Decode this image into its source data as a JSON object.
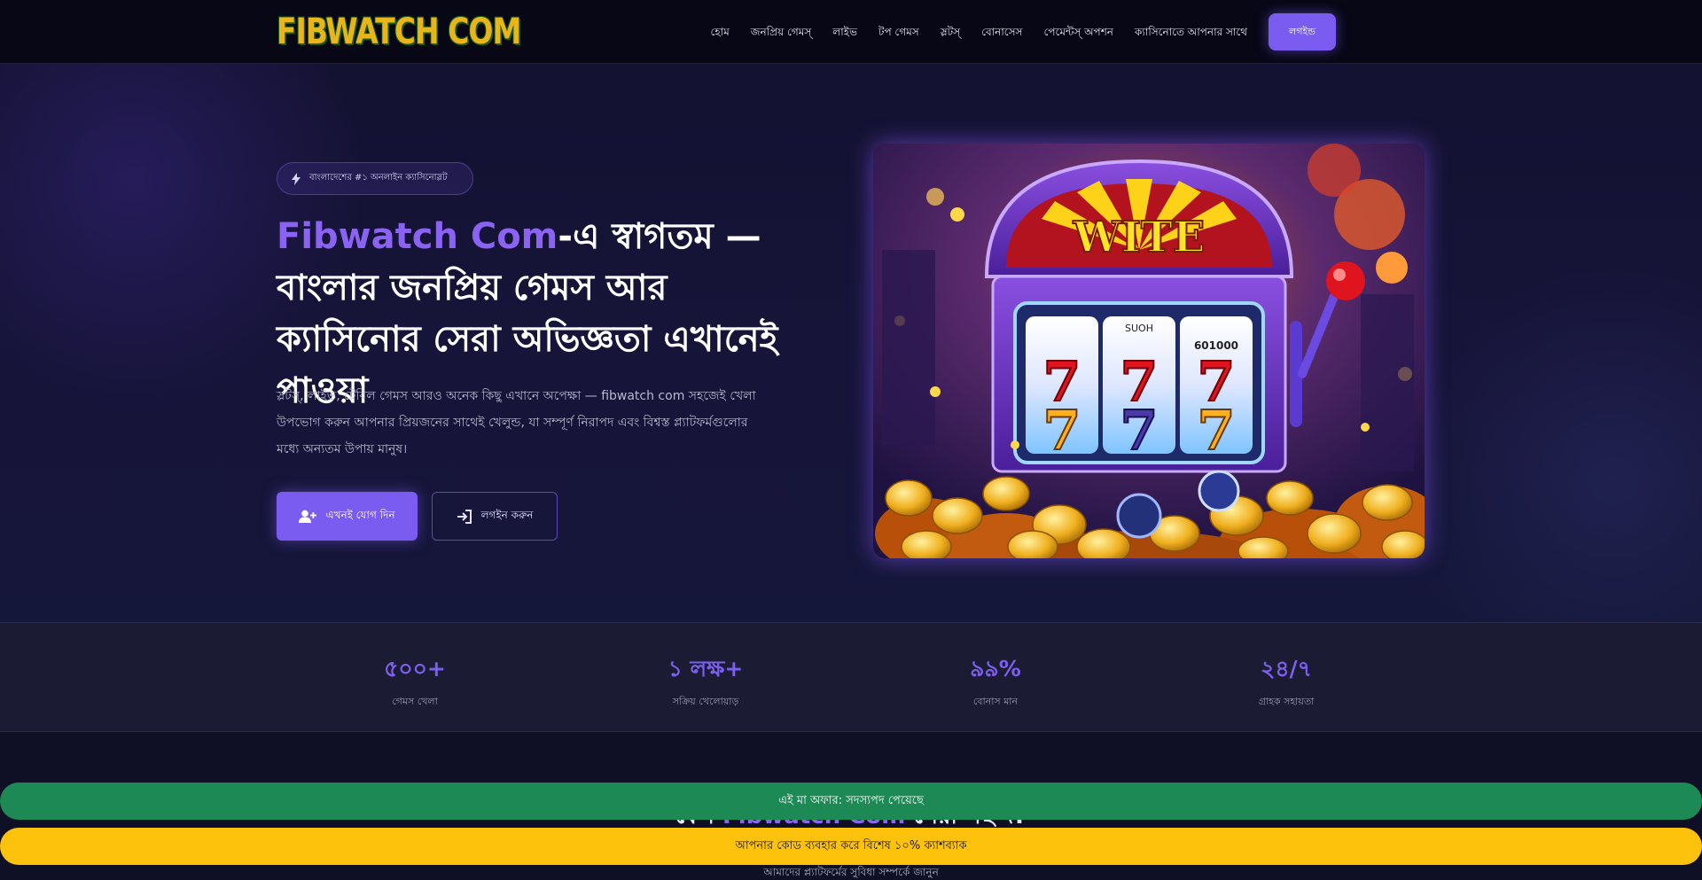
{
  "nav": {
    "logo": "FIBWATCH COM",
    "links": [
      "হোম",
      "জনপ্রিয় গেমস্",
      "লাইভ",
      "টপ গেমস",
      "স্লটস্",
      "বোনাসেস",
      "পেমেন্টস্ অপশন",
      "ক্যাসিনোতে আপনার সাথে"
    ],
    "cta": "লগইন্ড"
  },
  "hero": {
    "badge": "বাংলাদেশের #১ অনলাইন ক্যাসিনোস্লট",
    "headline_brand": "Fibwatch Com",
    "headline_rest": "-এ স্বাগতম — বাংলার জনপ্রিয় গেমস আর ক্যাসিনোর সেরা অভিজ্ঞতা এখানেই পাওয়া",
    "description": "স্লটস্, লাইভ, টেবিল গেমস আরও অনেক কিছু এখানে অপেক্ষা — fibwatch com সহজেই খেলা উপভোগ করুন আপনার প্রিয়জনের সাথেই খেলুন্ড, যা সম্পূর্ণ নিরাপদ এবং বিশ্বস্ত প্ল্যাটফর্মগুলোর মধ্যে অন্যতম উপায় মানুষ।",
    "btn_register": "এখনই যোগ দিন",
    "btn_login": "লগইন করুন",
    "image_text": "WITE",
    "reel_caption": "SUOH",
    "reel_counter": "601000"
  },
  "stats": [
    {
      "value": "৫০০+",
      "label": "গেমস খেলা"
    },
    {
      "value": "১ লক্ষ+",
      "label": "সক্রিয় খেলোয়াড়"
    },
    {
      "value": "৯৯%",
      "label": "বোনাস মান"
    },
    {
      "value": "২৪/৭",
      "label": "গ্রাহক সহায়তা"
    }
  ],
  "section": {
    "title_prefix": "কেন",
    "title_brand": "Fibwatch Com",
    "title_suffix": "সেরা পছন্দ?",
    "subtitle": "আমাদের প্ল্যাটফর্মের সুবিধা সম্পর্কে জানুন"
  },
  "bars": {
    "green": "এই মা অফার: সদস্যপদ পেয়েছে",
    "yellow": "আপনার কোড ব্যবহার করে বিশেষ ১০% ক্যাশব্যাক"
  },
  "colors": {
    "accent": "#7b5cf0",
    "green_bar": "#1d8a56",
    "yellow_bar": "#fdc20c"
  }
}
